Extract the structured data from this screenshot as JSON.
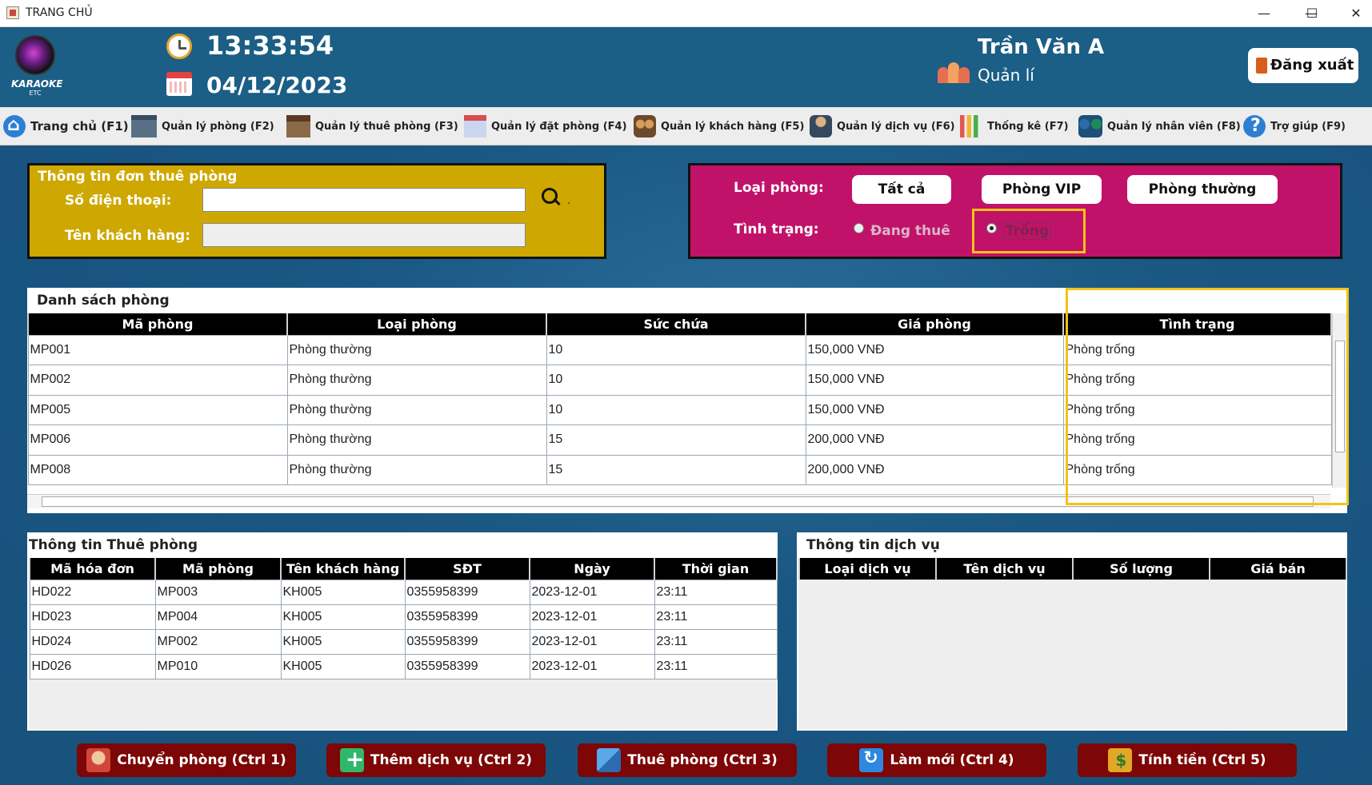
{
  "window": {
    "title": "TRANG CHỦ",
    "controls": [
      "—",
      "☐",
      "✕"
    ]
  },
  "header": {
    "logo_text": "KARAOKE",
    "logo_sub": "ETC",
    "time": "13:33:54",
    "date": "04/12/2023",
    "user_name": "Trần Văn A",
    "user_role": "Quản lí",
    "logout_label": "Đăng xuất"
  },
  "menu": [
    {
      "label": "Trang chủ (F1)",
      "icon": "home-icon"
    },
    {
      "label": "Quản lý phòng (F2)",
      "icon": "building-icon"
    },
    {
      "label": "Quản lý thuê phòng (F3)",
      "icon": "house-icon"
    },
    {
      "label": "Quản lý đặt phòng (F4)",
      "icon": "calendar-icon"
    },
    {
      "label": "Quản lý khách hàng (F5)",
      "icon": "customers-icon"
    },
    {
      "label": "Quản lý dịch vụ (F6)",
      "icon": "waiter-icon"
    },
    {
      "label": "Thống kê (F7)",
      "icon": "chart-icon"
    },
    {
      "label": "Quản lý nhân viên (F8)",
      "icon": "staff-icon"
    },
    {
      "label": "Trợ giúp (F9)",
      "icon": "help-icon"
    }
  ],
  "search_panel": {
    "title": "Thông tin đơn thuê phòng",
    "phone_label": "Số điện thoại:",
    "phone_value": "",
    "customer_label": "Tên khách hàng:",
    "customer_value": "",
    "trailing_mark": "."
  },
  "filter_panel": {
    "room_type_label": "Loại phòng:",
    "buttons": [
      "Tất cả",
      "Phòng VIP",
      "Phòng thường"
    ],
    "status_label": "Tình trạng:",
    "status_options": [
      {
        "label": "Đang thuê",
        "checked": false
      },
      {
        "label": "Trống",
        "checked": true
      }
    ],
    "highlight_color": "#f3c315"
  },
  "rooms": {
    "title": "Danh sách phòng",
    "columns": [
      "Mã phòng",
      "Loại phòng",
      "Sức chứa",
      "Giá phòng",
      "Tình trạng"
    ],
    "rows": [
      [
        "MP001",
        "Phòng thường",
        "10",
        "150,000 VNĐ",
        "Phòng trống"
      ],
      [
        "MP002",
        "Phòng thường",
        "10",
        "150,000 VNĐ",
        "Phòng trống"
      ],
      [
        "MP005",
        "Phòng thường",
        "10",
        "150,000 VNĐ",
        "Phòng trống"
      ],
      [
        "MP006",
        "Phòng thường",
        "15",
        "200,000 VNĐ",
        "Phòng trống"
      ],
      [
        "MP008",
        "Phòng thường",
        "15",
        "200,000 VNĐ",
        "Phòng trống"
      ]
    ]
  },
  "rental_info": {
    "title": "Thông tin Thuê phòng",
    "columns": [
      "Mã hóa đơn",
      "Mã phòng",
      "Tên khách hàng",
      "SĐT",
      "Ngày",
      "Thời gian"
    ],
    "rows": [
      [
        "HD022",
        "MP003",
        "KH005",
        "0355958399",
        "2023-12-01",
        "23:11"
      ],
      [
        "HD023",
        "MP004",
        "KH005",
        "0355958399",
        "2023-12-01",
        "23:11"
      ],
      [
        "HD024",
        "MP002",
        "KH005",
        "0355958399",
        "2023-12-01",
        "23:11"
      ],
      [
        "HD026",
        "MP010",
        "KH005",
        "0355958399",
        "2023-12-01",
        "23:11"
      ]
    ]
  },
  "service_info": {
    "title": "Thông tin dịch vụ",
    "columns": [
      "Loại dịch vụ",
      "Tên dịch vụ",
      "Số lượng",
      "Giá bán"
    ],
    "rows": []
  },
  "actions": [
    {
      "label": "Chuyển phòng (Ctrl 1)",
      "icon": "transfer-icon"
    },
    {
      "label": "Thêm dịch vụ (Ctrl 2)",
      "icon": "add-icon"
    },
    {
      "label": "Thuê phòng (Ctrl 3)",
      "icon": "key-icon"
    },
    {
      "label": "Làm mới (Ctrl 4)",
      "icon": "refresh-icon"
    },
    {
      "label": "Tính tiền (Ctrl 5)",
      "icon": "money-icon"
    }
  ],
  "colors": {
    "header_bg": "#1b5e86",
    "search_panel_bg": "#cea700",
    "filter_panel_bg": "#c1126a",
    "action_button_bg": "#7d0606"
  }
}
